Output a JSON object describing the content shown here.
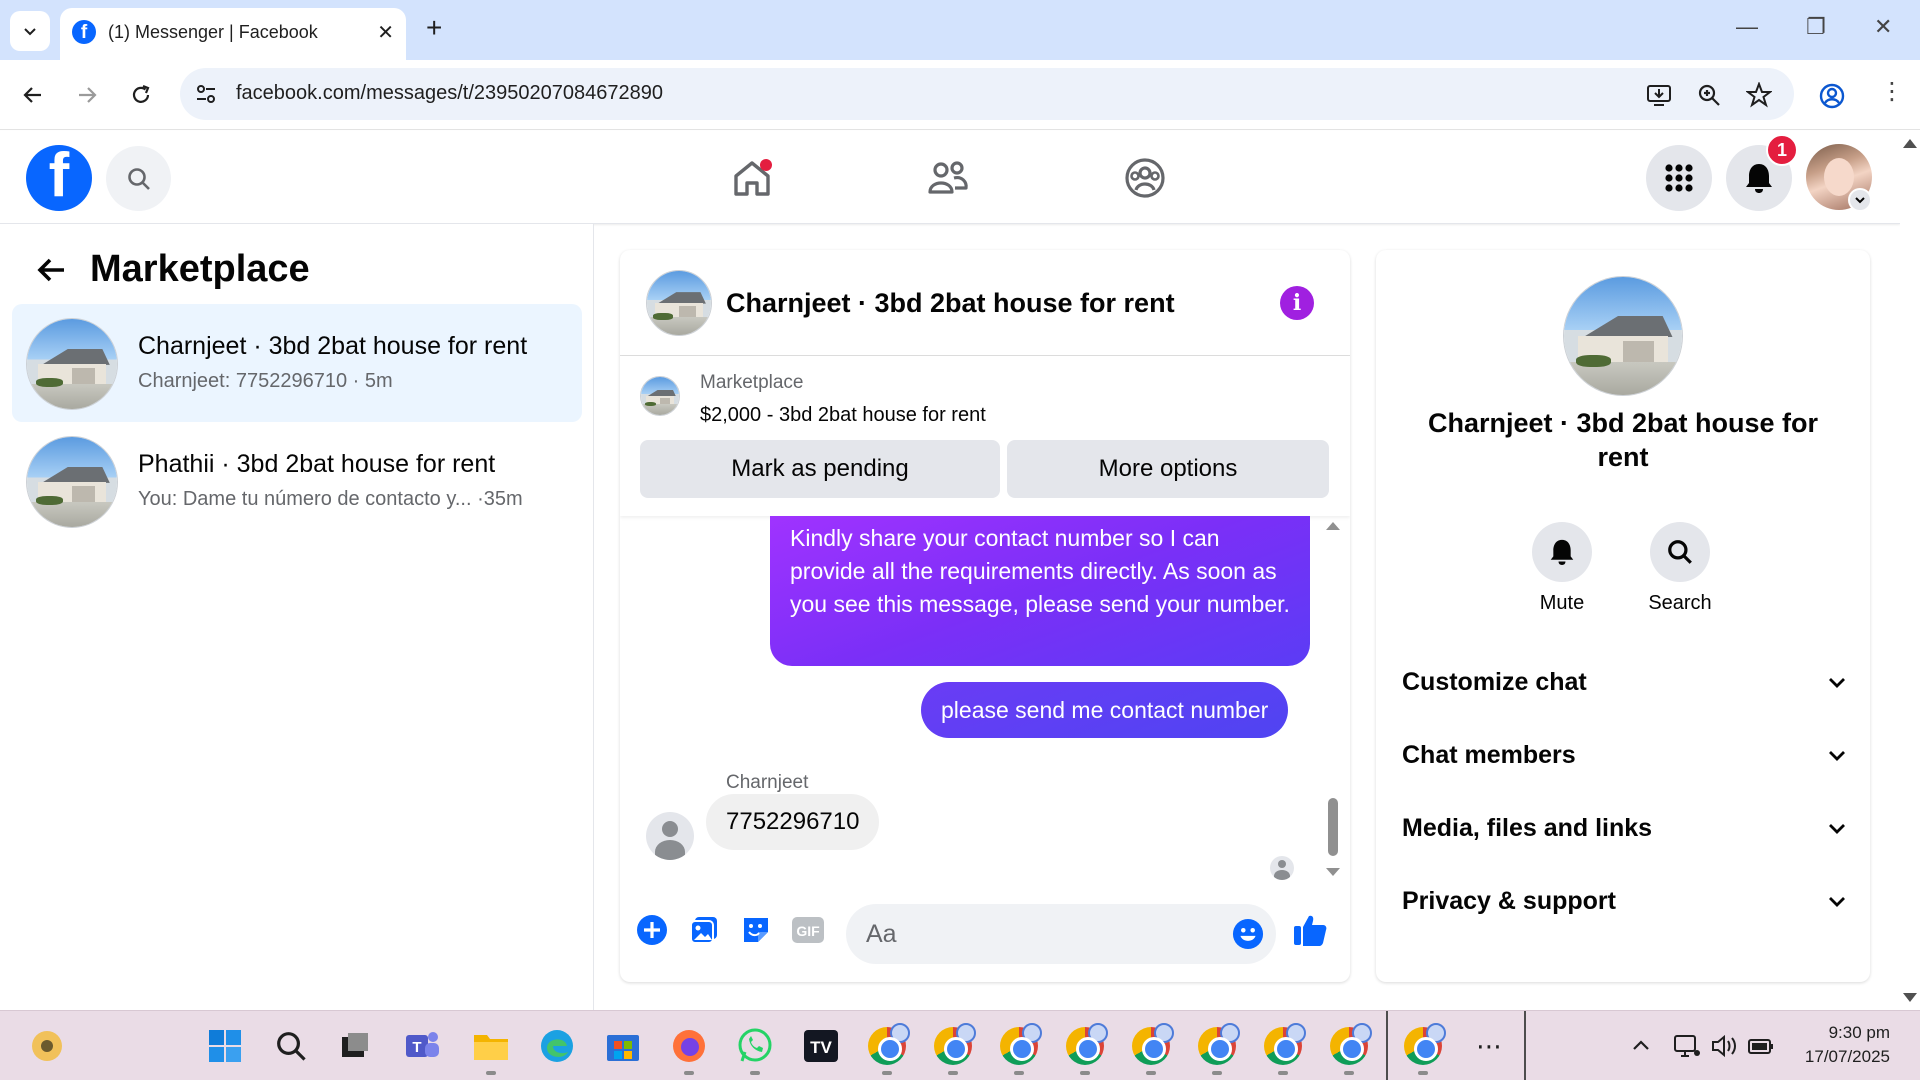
{
  "browser": {
    "tab_title": "(1) Messenger | Facebook",
    "url": "facebook.com/messages/t/23950207084672890"
  },
  "fb_header": {
    "notification_count": "1"
  },
  "left_panel": {
    "title": "Marketplace",
    "conversations": [
      {
        "name": "Charnjeet · 3bd 2bat house for rent",
        "snippet": "Charnjeet: 7752296710 · 5m",
        "active": true
      },
      {
        "name": "Phathii · 3bd 2bat house for rent",
        "snippet": "You: Dame tu número de contacto y... ·35m",
        "active": false
      }
    ]
  },
  "chat": {
    "title": "Charnjeet · 3bd 2bat house for rent",
    "marketplace_label": "Marketplace",
    "listing": "$2,000 - 3bd 2bat house for rent",
    "mark_pending": "Mark as pending",
    "more_options": "More options",
    "messages": {
      "out1": "Kindly share your contact number so I can provide all the requirements directly. As soon as you see this message, please send your number.",
      "out2": "please send me contact number",
      "sender": "Charnjeet",
      "in1": "7752296710"
    },
    "composer_placeholder": "Aa"
  },
  "right_panel": {
    "name": "Charnjeet · 3bd 2bat house for rent",
    "mute": "Mute",
    "search": "Search",
    "sections": [
      "Customize chat",
      "Chat members",
      "Media, files and links",
      "Privacy & support"
    ]
  },
  "taskbar": {
    "time": "9:30 pm",
    "date": "17/07/2025"
  },
  "colors": {
    "fb_blue": "#0866ff",
    "messenger_purple": "#a033ff",
    "active_conv": "#ebf5ff"
  }
}
